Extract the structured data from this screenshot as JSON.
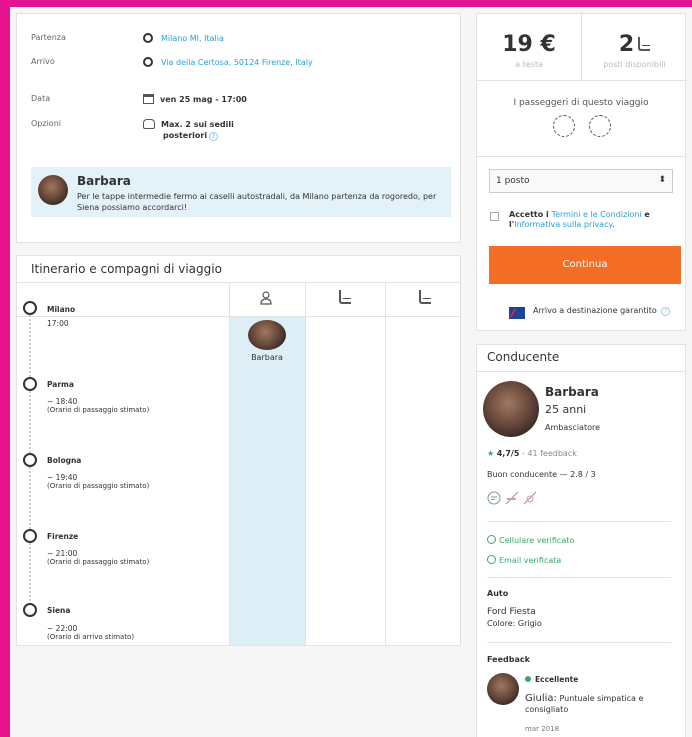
{
  "trip": {
    "departure_label": "Partenza",
    "departure_value": "Milano MI, Italia",
    "arrival_label": "Arrivo",
    "arrival_value": "Via della Certosa, 50124 Firenze, Italy",
    "date_label": "Data",
    "date_value": "ven 25 mag - 17:00",
    "options_label": "Opzioni",
    "options_value_1": "Max. 2 sui sedili",
    "options_value_2": "posteriori",
    "info_icon": "?"
  },
  "message": {
    "author": "Barbara",
    "text": "Per le tappe intermedie fermo ai caselli autostradali, da Milano partenza da rogoredo, per Siena possiamo accordarci!"
  },
  "itinerary": {
    "title": "Itinerario e compagni di viaggio",
    "passenger_name": "Barbara",
    "stops": [
      {
        "city": "Milano",
        "time": "17:00",
        "note": ""
      },
      {
        "city": "Parma",
        "time": "~ 18:40",
        "note": "(Orario di passaggio stimato)"
      },
      {
        "city": "Bologna",
        "time": "~ 19:40",
        "note": "(Orario di passaggio stimato)"
      },
      {
        "city": "Firenze",
        "time": "~ 21:00",
        "note": "(Orario di passaggio stimato)"
      },
      {
        "city": "Siena",
        "time": "~ 22:00",
        "note": "(Orario di arrivo stimato)"
      }
    ]
  },
  "booking": {
    "price": "19 €",
    "price_sub": "a testa",
    "seats": "2",
    "seats_sub": "posti disponibili",
    "passengers_title": "I passeggeri di questo viaggio",
    "seat_select": "1 posto",
    "terms_prefix": "Accetto i ",
    "terms_link": "Termini e le Condizioni",
    "terms_mid": " e l'",
    "privacy_link": "Informativa sulla privacy",
    "terms_end": ".",
    "continue_label": "Continua",
    "guarantee": "Arrivo a destinazione garantito",
    "guarantee_icon": "?"
  },
  "driver": {
    "header": "Conducente",
    "name": "Barbara",
    "age": "25 anni",
    "level": "Ambasciatore",
    "rating": "4,7/5",
    "feedback_count": "- 41 feedback",
    "good_driver": "Buon conducente — 2.8 / 3",
    "phone_verified": "Cellulare verificato",
    "email_verified": "Email verificata",
    "car_header": "Auto",
    "car_model": "Ford Fiesta",
    "car_color": "Colore: Grigio",
    "feedback_header": "Feedback",
    "feedback_level": "Eccellente",
    "feedback_author": "Giulia:",
    "feedback_text": "Puntuale simpatica e consigliato",
    "feedback_date": "mar 2018"
  },
  "colors": {
    "frame": "#e6158f",
    "accent_blue": "#2a9fd6",
    "button_orange": "#f36d24",
    "verified_green": "#3aa76d"
  }
}
